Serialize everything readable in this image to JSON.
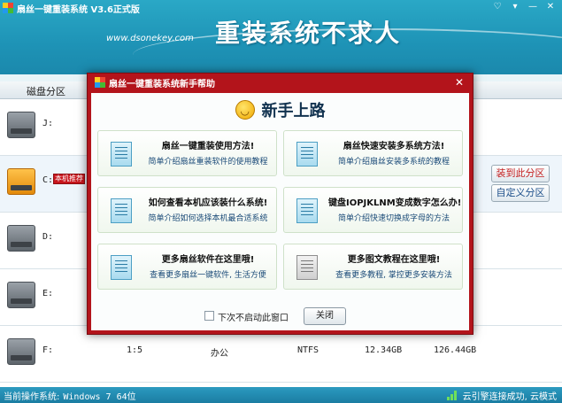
{
  "app": {
    "title": "扇丝一键重装系统 V3.6正式版",
    "site_url": "www.dsonekey.com",
    "slogan": "重装系统不求人"
  },
  "list": {
    "column_partition": "磁盘分区",
    "rows": [
      {
        "letter": "J:",
        "drive_type": "normal"
      },
      {
        "letter": "C:",
        "drive_type": "system",
        "badge": "本机推荐"
      },
      {
        "letter": "D:",
        "drive_type": "normal"
      },
      {
        "letter": "E:",
        "drive_type": "normal"
      },
      {
        "letter": "F:",
        "drive_type": "normal",
        "ratio": "1:5",
        "label": "办公",
        "fs": "NTFS",
        "total": "12.34GB",
        "free": "126.44GB"
      }
    ],
    "side_buttons": {
      "install_here": "装到此分区",
      "custom_partition": "自定义分区"
    }
  },
  "status": {
    "current_os_label": "当前操作系统:",
    "current_os_value": "Windows 7 64位",
    "cloud_status": "云引擎连接成功, 云模式"
  },
  "modal": {
    "title": "扇丝一键重装系统新手帮助",
    "heading": "新手上路",
    "cards": [
      {
        "title": "扇丝一键重装使用方法!",
        "desc": "简单介绍扇丝重装软件的使用教程",
        "icon": "document-icon"
      },
      {
        "title": "扇丝快速安装多系统方法!",
        "desc": "简单介绍扇丝安装多系统的教程",
        "icon": "document-icon"
      },
      {
        "title": "如何查看本机应该装什么系统!",
        "desc": "简单介绍如何选择本机最合适系统",
        "icon": "document-icon"
      },
      {
        "title": "键盘IOPJKLNM变成数字怎么办!",
        "desc": "简单介绍快速切换成字母的方法",
        "icon": "document-icon"
      },
      {
        "title": "更多扇丝软件在这里哦!",
        "desc": "查看更多扇丝一键软件, 生活方便",
        "icon": "document-icon"
      },
      {
        "title": "更多图文教程在这里哦!",
        "desc": "查看更多教程, 掌控更多安装方法",
        "icon": "newspaper-icon"
      }
    ],
    "checkbox_label": "下次不启动此窗口",
    "close_label": "关闭"
  },
  "colors": {
    "header": "#1e93b6",
    "modal_frame": "#b3141b",
    "badge": "#c8161d"
  }
}
